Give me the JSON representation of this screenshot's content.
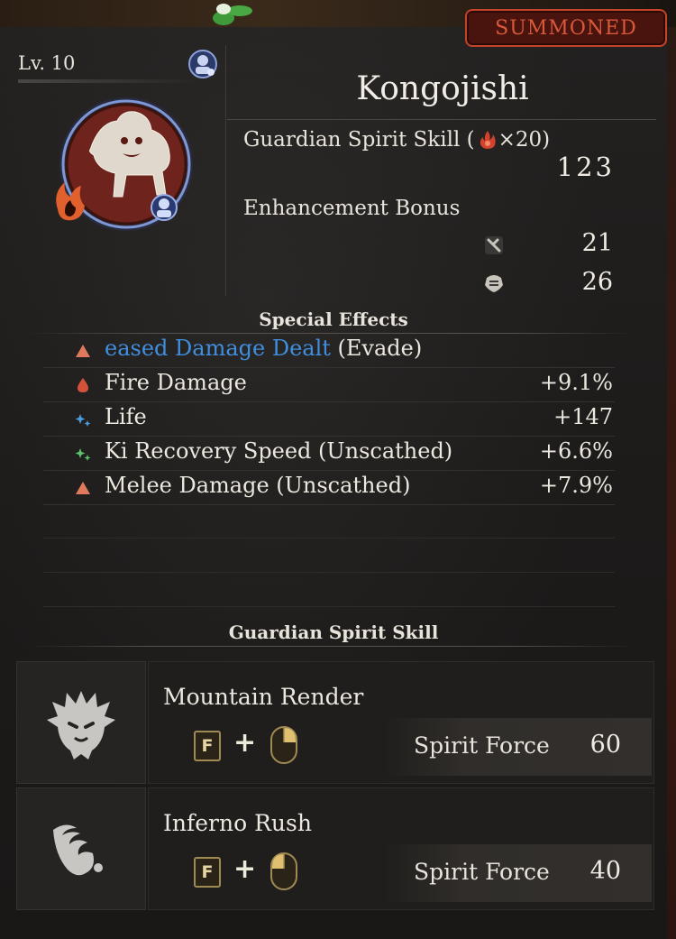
{
  "status_badge": "SUMMONED",
  "level": "Lv. 10",
  "spirit": {
    "name": "Kongojishi",
    "skill_label": "Guardian Spirit Skill (",
    "skill_cost": "×20)",
    "skill_value": "123",
    "bonus_title": "Enhancement Bonus",
    "bonuses": [
      {
        "icon": "weapon-icon",
        "value": "21"
      },
      {
        "icon": "armor-icon",
        "value": "26"
      }
    ]
  },
  "special_effects": {
    "title": "Special Effects",
    "items": [
      {
        "icon": "triangle-up-icon",
        "name_highlight": "eased Damage Dealt",
        "name_rest": " (Evade)",
        "value": ""
      },
      {
        "icon": "fire-drop-icon",
        "name_highlight": "",
        "name_rest": "Fire Damage",
        "value": "+9.1%"
      },
      {
        "icon": "sparkle-blue-icon",
        "name_highlight": "",
        "name_rest": "Life",
        "value": "+147"
      },
      {
        "icon": "sparkle-green-icon",
        "name_highlight": "",
        "name_rest": "Ki Recovery Speed (Unscathed)",
        "value": "+6.6%"
      },
      {
        "icon": "triangle-up-icon",
        "name_highlight": "",
        "name_rest": "Melee Damage (Unscathed)",
        "value": "+7.9%"
      }
    ]
  },
  "guardian_skills": {
    "title": "Guardian Spirit Skill",
    "items": [
      {
        "name": "Mountain Render",
        "key": "F",
        "plus": "+",
        "force_label": "Spirit Force",
        "force_value": "60",
        "icon": "beast-head-icon"
      },
      {
        "name": "Inferno Rush",
        "key": "F",
        "plus": "+",
        "force_label": "Spirit Force",
        "force_value": "40",
        "icon": "claw-icon"
      }
    ]
  },
  "colors": {
    "badge": "#c4432a",
    "highlight": "#3f8fe0",
    "fire": "#d4523a",
    "life": "#4aa0e0",
    "ki": "#5ec46a"
  }
}
